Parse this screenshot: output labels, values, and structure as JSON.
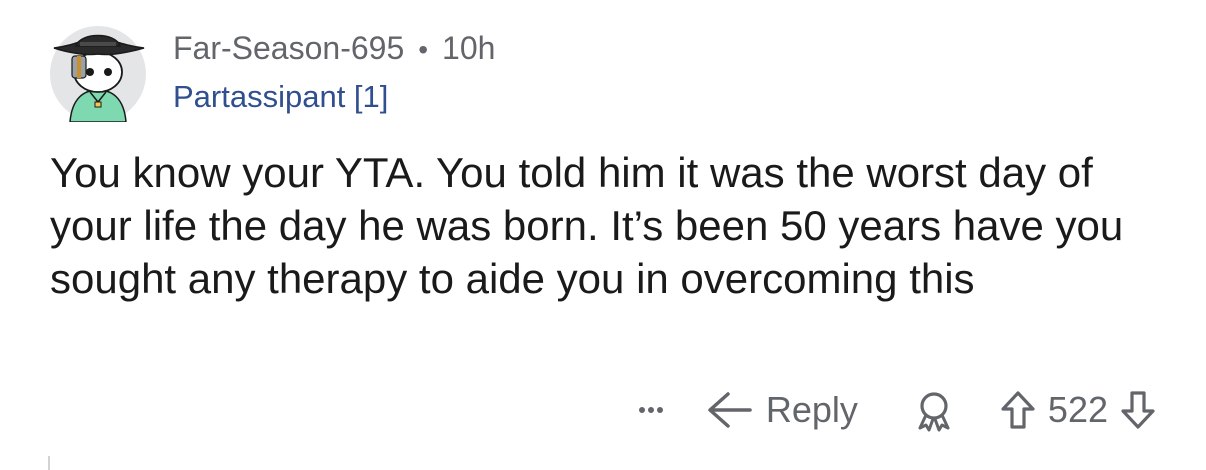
{
  "comment": {
    "username": "Far-Season-695",
    "separator": "•",
    "age": "10h",
    "flair": "Partassipant [1]",
    "body": "You know your YTA. You told him it was the worst day of your life the day he was born. It’s been 50 years have you sought any therapy to aide you in overcoming this"
  },
  "actions": {
    "more_icon": "more-dots-icon",
    "reply_icon": "reply-arrow-icon",
    "reply_label": "Reply",
    "award_icon": "award-icon",
    "upvote_icon": "upvote-arrow-icon",
    "score": "522",
    "downvote_icon": "downvote-arrow-icon"
  },
  "colors": {
    "meta_text": "#62656a",
    "flair_text": "#2f4f8f",
    "body_text": "#1a1a1b",
    "avatar_bg": "#e4e5e7",
    "avatar_shirt": "#7ed8b0",
    "background": "#ffffff"
  }
}
